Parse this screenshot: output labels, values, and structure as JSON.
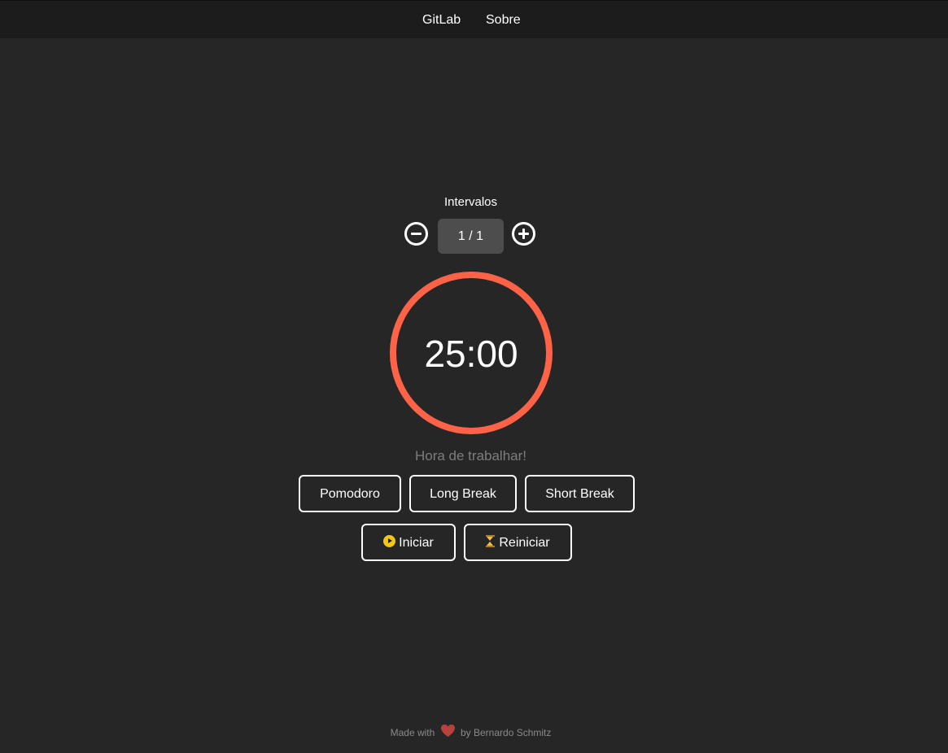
{
  "nav": {
    "items": [
      {
        "label": "GitLab"
      },
      {
        "label": "Sobre"
      }
    ]
  },
  "intervals": {
    "label": "Intervalos",
    "value": "1 / 1",
    "decrement_icon": "minus-circle-icon",
    "increment_icon": "plus-circle-icon"
  },
  "timer": {
    "time": "25:00",
    "status": "Hora de trabalhar!",
    "ring_color": "#ff6347",
    "progress_percent": 100
  },
  "modes": [
    {
      "label": "Pomodoro"
    },
    {
      "label": "Long Break"
    },
    {
      "label": "Short Break"
    }
  ],
  "controls": {
    "start_label": "Iniciar",
    "start_icon": "play-icon",
    "reset_label": "Reiniciar",
    "reset_icon": "hourglass-icon"
  },
  "footer": {
    "prefix": "Made with",
    "suffix": "by Bernardo Schmitz",
    "heart_icon": "heart-icon",
    "heart_color": "#b7423b"
  },
  "colors": {
    "background": "#262626",
    "topbar": "#1c1c1c",
    "accent": "#ff6347"
  }
}
